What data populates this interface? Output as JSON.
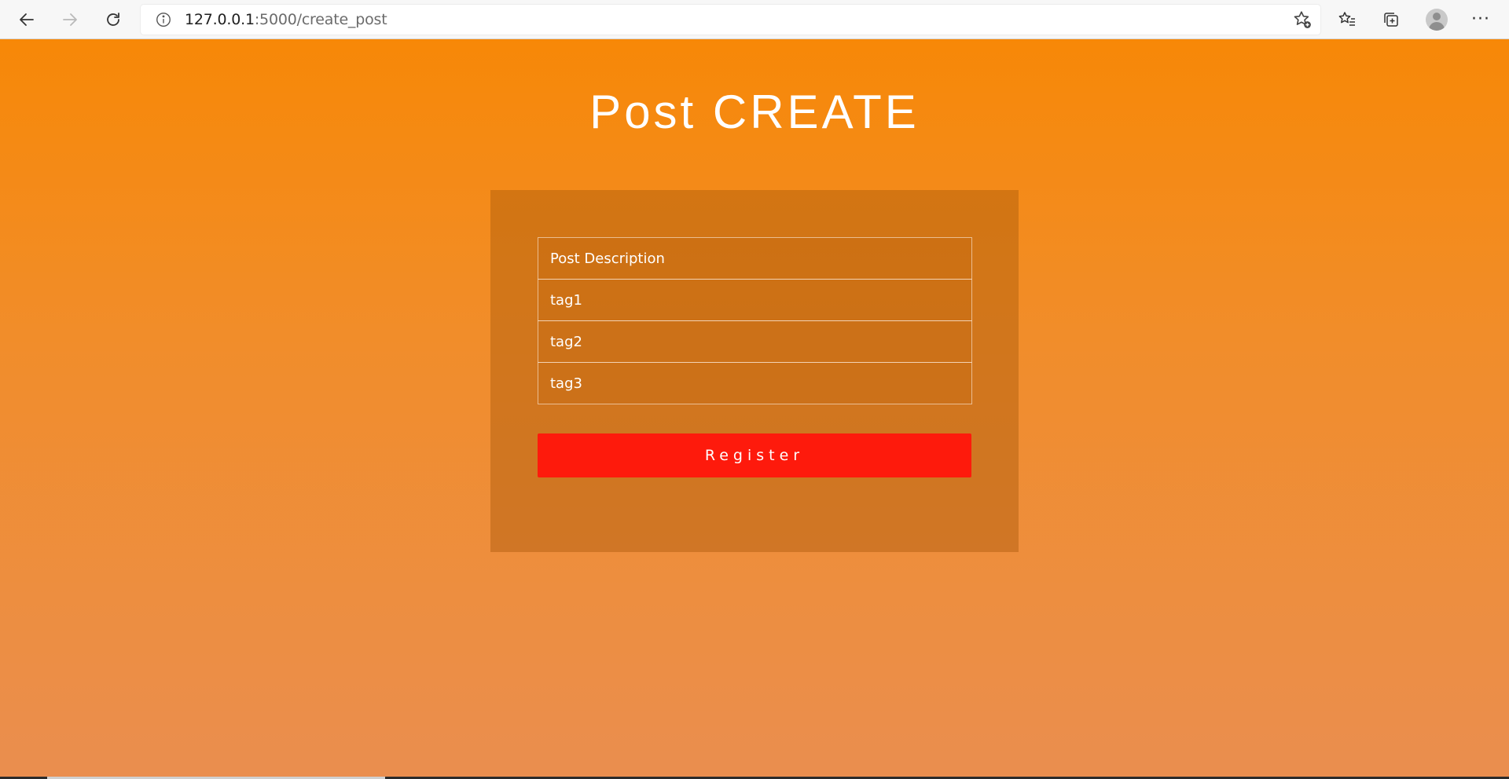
{
  "browser": {
    "url_host": "127.0.0.1",
    "url_path": ":5000/create_post",
    "icons": {
      "back": "back-arrow-icon",
      "forward": "forward-arrow-icon",
      "refresh": "refresh-icon",
      "info": "info-icon",
      "favorite_add": "star-add-icon",
      "favorites": "favorites-list-icon",
      "collections": "collections-icon",
      "profile": "profile-avatar-icon",
      "menu": "more-menu-icon"
    },
    "menu_glyph": "···"
  },
  "page": {
    "title": "Post CREATE",
    "gradient_top": "#f78807",
    "gradient_bottom": "#ea8e4f"
  },
  "form": {
    "fields": [
      {
        "placeholder": "Post Description",
        "value": ""
      },
      {
        "placeholder": "tag1",
        "value": ""
      },
      {
        "placeholder": "tag2",
        "value": ""
      },
      {
        "placeholder": "tag3",
        "value": ""
      }
    ],
    "submit_label": "Register",
    "submit_color": "#fe1a0c"
  }
}
